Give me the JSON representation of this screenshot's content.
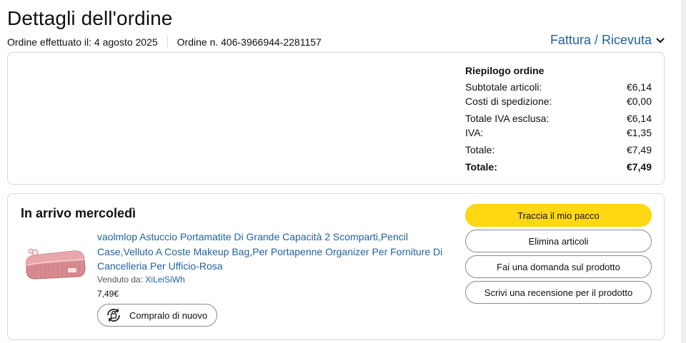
{
  "header": {
    "title": "Dettagli dell'ordine",
    "order_placed": "Ordine effettuato il: 4 agosto 2025",
    "order_number": "Ordine n. 406-3966944-2281157",
    "invoice_link": "Fattura / Ricevuta"
  },
  "summary": {
    "title": "Riepilogo ordine",
    "rows": [
      {
        "label": "Subtotale articoli:",
        "value": "€6,14"
      },
      {
        "label": "Costi di spedizione:",
        "value": "€0,00"
      },
      {
        "label": "Totale IVA esclusa:",
        "value": "€6,14"
      },
      {
        "label": "IVA:",
        "value": "€1,35"
      },
      {
        "label": "Totale:",
        "value": "€7,49"
      },
      {
        "label": "Totale:",
        "value": "€7,49"
      }
    ]
  },
  "shipment": {
    "heading": "In arrivo mercoledì",
    "product": {
      "title": "vaolmlop Astuccio Portamatite Di Grande Capacità 2 Scomparti,Pencil Case,Velluto A Coste Makeup Bag,Per Portapenne Organizer Per Forniture Di Cancelleria Per Ufficio-Rosa",
      "seller_label": "Venduto da:",
      "seller_name": "XiLeiSiWh",
      "price": "7,49€",
      "buy_again": "Compralo di nuovo",
      "image": "pink-corduroy-pencil-case"
    },
    "actions": {
      "track": "Traccia il mio pacco",
      "remove": "Elimina articoli",
      "question": "Fai una domanda sul prodotto",
      "review": "Scrivi una recensione per il prodotto"
    }
  },
  "colors": {
    "link": "#2162a1",
    "primary_button": "#ffd814",
    "border": "#d5d9d9"
  }
}
